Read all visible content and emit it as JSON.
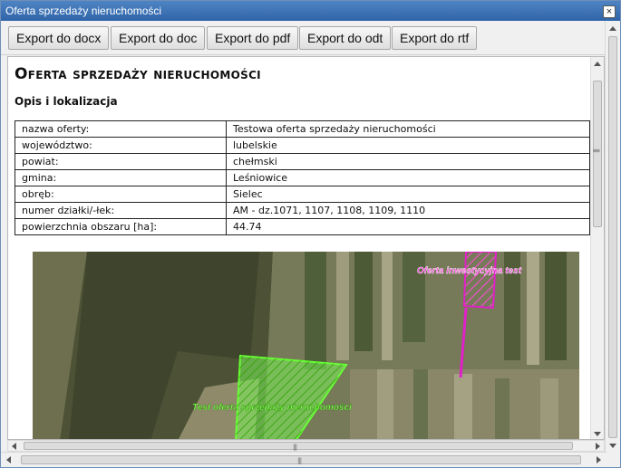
{
  "window": {
    "title": "Oferta sprzedaży nieruchomości",
    "close_label": "×"
  },
  "toolbar": {
    "buttons": [
      {
        "label": "Export do docx"
      },
      {
        "label": "Export do doc"
      },
      {
        "label": "Export do pdf"
      },
      {
        "label": "Export do odt"
      },
      {
        "label": "Export do rtf"
      }
    ]
  },
  "document": {
    "title": "Oferta sprzedaży nieruchomości",
    "section": "Opis i lokalizacja",
    "rows": [
      {
        "label": "nazwa oferty:",
        "value": "Testowa oferta sprzedaży nieruchomości"
      },
      {
        "label": "województwo:",
        "value": "lubelskie"
      },
      {
        "label": "powiat:",
        "value": "chełmski"
      },
      {
        "label": "gmina:",
        "value": "Leśniowice"
      },
      {
        "label": "obręb:",
        "value": "Sielec"
      },
      {
        "label": "numer działki/-łek:",
        "value": "AM - dz.1071, 1107, 1108, 1109, 1110"
      },
      {
        "label": "powierzchnia obszaru [ha]:",
        "value": "44.74"
      }
    ]
  },
  "map": {
    "label_investment": "Oferta inwestycyjna test",
    "label_sale": "Test oferta sprzedaży nieruchomości",
    "colors": {
      "investment": "#e020c8",
      "sale": "#66ff33"
    }
  },
  "scroll": {
    "grip": "|||"
  }
}
